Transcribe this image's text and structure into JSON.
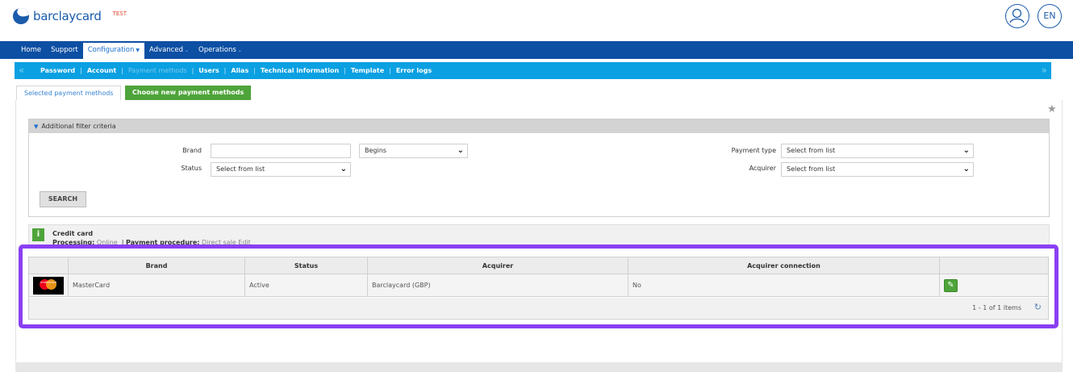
{
  "header": {
    "brand": "barclaycard",
    "env_badge": "TEST",
    "language": "EN"
  },
  "main_nav": [
    {
      "label": "Home"
    },
    {
      "label": "Support"
    },
    {
      "label": "Configuration"
    },
    {
      "label": "Advanced"
    },
    {
      "label": "Operations"
    }
  ],
  "sub_nav": [
    {
      "label": "Password"
    },
    {
      "label": "Account"
    },
    {
      "label": "Payment methods"
    },
    {
      "label": "Users"
    },
    {
      "label": "Alias"
    },
    {
      "label": "Technical information"
    },
    {
      "label": "Template"
    },
    {
      "label": "Error logs"
    }
  ],
  "tabs": {
    "selected": "Selected payment methods",
    "new": "Choose new payment methods"
  },
  "filter": {
    "title": "Additional filter criteria",
    "brand_label": "Brand",
    "brand_value": "",
    "match_mode": "Begins",
    "status_label": "Status",
    "status_value": "Select from list",
    "payment_type_label": "Payment type",
    "payment_type_value": "Select from list",
    "acquirer_label": "Acquirer",
    "acquirer_value": "Select from list",
    "search_button": "SEARCH"
  },
  "credit_card": {
    "title": "Credit card",
    "processing_label": "Processing:",
    "processing_value": "Online",
    "procedure_label": "Payment procedure:",
    "procedure_value": "Direct sale",
    "edit_link": "Edit"
  },
  "grid": {
    "columns": [
      "Brand",
      "Status",
      "Acquirer",
      "Acquirer connection"
    ],
    "rows": [
      {
        "logo_text": "mastercard",
        "brand": "MasterCard",
        "status": "Active",
        "acquirer": "Barclaycard (GBP)",
        "connection": "No"
      }
    ],
    "pager": "1 - 1 of 1 items"
  },
  "colors": {
    "primary_nav": "#0c4fa3",
    "sub_nav": "#0aa0e2",
    "accent_green": "#4ea43a",
    "highlight": "#8a3ff2"
  }
}
